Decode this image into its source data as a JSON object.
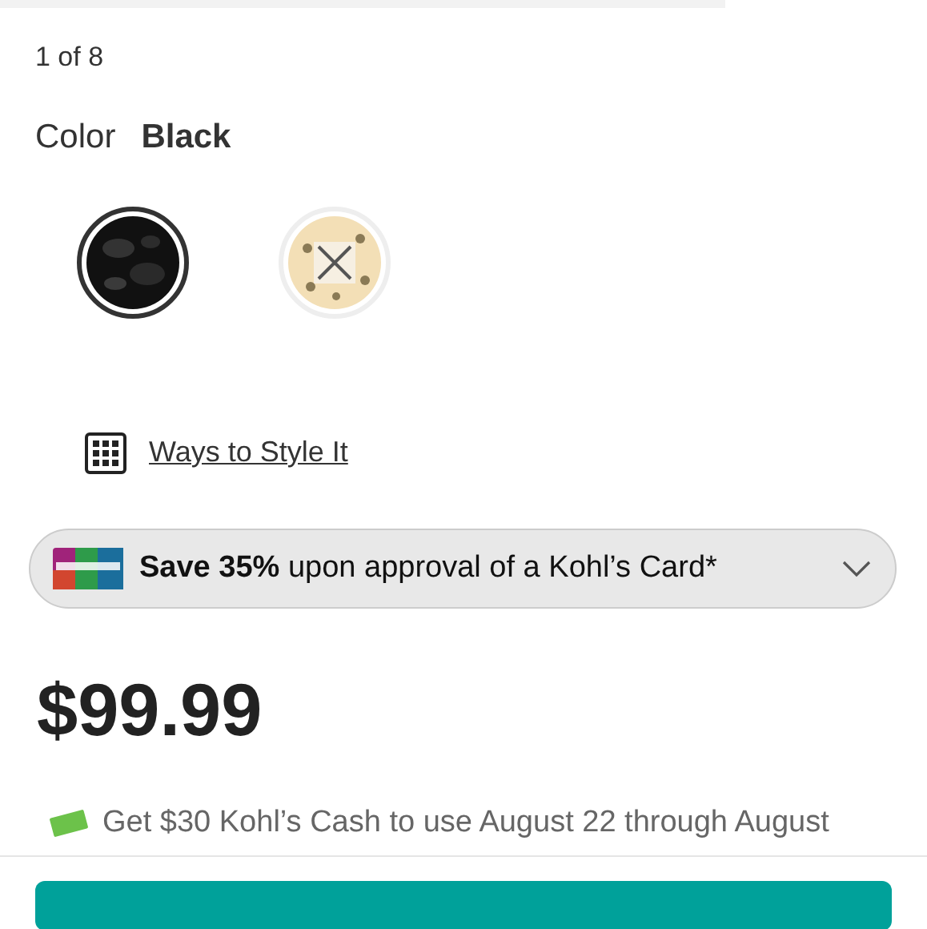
{
  "gallery": {
    "counter": "1 of 8"
  },
  "color": {
    "label": "Color",
    "value": "Black"
  },
  "swatches": [
    {
      "kind": "dark",
      "selected": true
    },
    {
      "kind": "unavailable",
      "selected": false
    }
  ],
  "style_link": "Ways to Style It",
  "promo": {
    "text": "**Save 35%** upon approval of a Kohl’s Card*",
    "expanded": false
  },
  "price": "$99.99",
  "cash_offer": "Get $30 Kohl’s Cash to use August 22 through August"
}
